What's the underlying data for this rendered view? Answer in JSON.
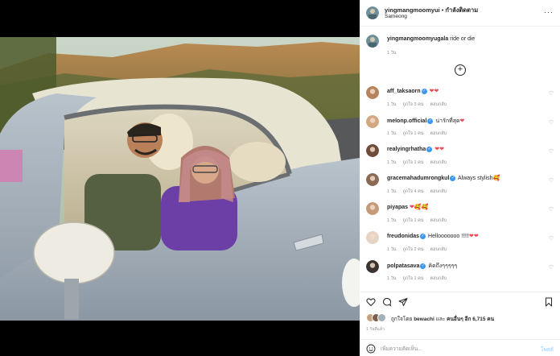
{
  "header": {
    "username": "yingmangmoomyui",
    "separator": "•",
    "follow_label": "กำลังติดตาม",
    "location": "Sameong",
    "more_label": "···"
  },
  "caption": {
    "username": "yingmangmoomyugala",
    "text": "ride or die",
    "time": "1 วัน"
  },
  "comments": [
    {
      "username": "aff_taksaorn",
      "verified": true,
      "text": "",
      "hearts": 2,
      "emoji": "",
      "time": "1 วัน",
      "likes": "ถูกใจ 3 คน",
      "reply": "ตอบกลับ"
    },
    {
      "username": "melonp.official",
      "verified": true,
      "text": "น่ารักที่สุด",
      "hearts": 1,
      "emoji": "",
      "time": "1 วัน",
      "likes": "ถูกใจ 1 คน",
      "reply": "ตอบกลับ"
    },
    {
      "username": "realyingrhatha",
      "verified": true,
      "text": "",
      "hearts": 2,
      "emoji": "",
      "time": "1 วัน",
      "likes": "ถูกใจ 1 คน",
      "reply": "ตอบกลับ"
    },
    {
      "username": "gracemahadumrongkul",
      "verified": true,
      "text": "Always stylish",
      "hearts": 0,
      "emoji": "🥰",
      "time": "1 วัน",
      "likes": "ถูกใจ 4 คน",
      "reply": "ตอบกลับ"
    },
    {
      "username": "piyapas",
      "verified": false,
      "text": "",
      "hearts": 1,
      "emoji": "🥰🥰",
      "time": "1 วัน",
      "likes": "ถูกใจ 1 คน",
      "reply": "ตอบกลับ"
    },
    {
      "username": "freudonidas",
      "verified": true,
      "text": "Hellooooooo !!!!!",
      "hearts": 2,
      "emoji": "",
      "time": "1 วัน",
      "likes": "ถูกใจ 2 คน",
      "reply": "ตอบกลับ"
    },
    {
      "username": "polpatasava",
      "verified": true,
      "text": "คิดถึงๆๆๆๆๆ",
      "hearts": 0,
      "emoji": "",
      "time": "1 วัน",
      "likes": "ถูกใจ 1 คน",
      "reply": "ตอบกลับ"
    }
  ],
  "likes": {
    "prefix": "ถูกใจโดย",
    "user": "bewachi",
    "middle": "และ",
    "others": "คนอื่นๆ อีก 6,715 คน"
  },
  "post_time": "1 วันที่แล้ว",
  "add_comment": {
    "placeholder": "เพิ่มความคิดเห็น...",
    "post_label": "โพสต์"
  },
  "icons": {
    "like": "heart-icon",
    "comment": "comment-icon",
    "share": "share-icon",
    "save": "bookmark-icon",
    "load_more": "plus-circle-icon",
    "emoji": "smile-icon"
  },
  "colors": {
    "verified": "#3897f0",
    "heart": "#ed4956",
    "muted": "#8e8e8e",
    "post_disabled": "#b3dbff"
  }
}
